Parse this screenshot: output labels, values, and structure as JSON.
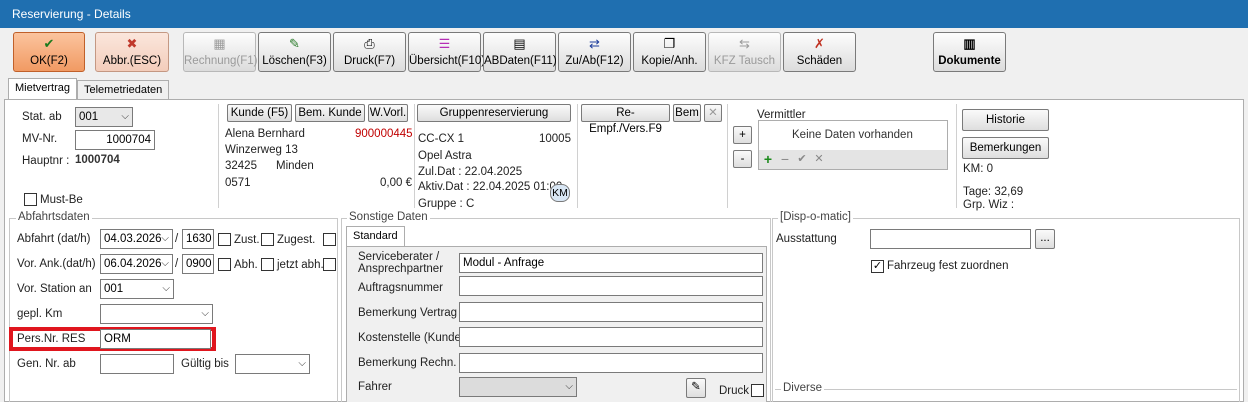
{
  "window": {
    "title": "Reservierung - Details"
  },
  "toolbar": {
    "ok": "OK(F2)",
    "abbr": "Abbr.(ESC)",
    "rechnung": "Rechnung(F1)",
    "loeschen": "Löschen(F3)",
    "druck": "Druck(F7)",
    "uebersicht": "Übersicht(F10)",
    "abdaten": "ABDaten(F11)",
    "zuab": "Zu/Ab(F12)",
    "kopie": "Kopie/Anh.",
    "kfz": "KFZ Tausch",
    "schaeden": "Schäden",
    "dokumente": "Dokumente"
  },
  "tabs": {
    "mietvertrag": "Mietvertrag",
    "telemetrie": "Telemetriedaten"
  },
  "header": {
    "stat_label": "Stat. ab",
    "stat_value": "001",
    "mv_label": "MV-Nr.",
    "mv_value": "1000704",
    "haupt_label": "Hauptnr :",
    "haupt_value": "1000704",
    "mustbe": "Must-Be"
  },
  "kunde": {
    "btn_kunde": "Kunde (F5)",
    "btn_bem": "Bem. Kunde",
    "btn_wvorl": "W.Vorl.",
    "name": "Alena Bernhard",
    "nr": "900000445",
    "street": "Winzerweg 13",
    "zip": "32425",
    "city": "Minden",
    "code": "0571",
    "amount": "0,00 €"
  },
  "fahrzeug": {
    "btn_gruppe": "Gruppenreservierung",
    "kennz": "CC-CX 1",
    "nr": "10005",
    "model": "Opel Astra",
    "zul": "Zul.Dat :  22.04.2025",
    "aktiv": "Aktiv.Dat : 22.04.2025 01:00",
    "gruppe": "Gruppe :   C",
    "km_btn": "KM"
  },
  "empf": {
    "btn_re": "Re-Empf./Vers.F9",
    "btn_bem": "Bem",
    "btn_x": "✕"
  },
  "vermittler": {
    "label": "Vermittler",
    "empty": "Keine Daten vorhanden",
    "plus": "+",
    "minus": "-"
  },
  "right": {
    "historie": "Historie",
    "bemerkungen": "Bemerkungen",
    "km": "KM: 0",
    "tage": "Tage: 32,69",
    "grp": "Grp. Wiz :"
  },
  "abfahrt": {
    "title": "Abfahrtsdaten",
    "abfahrt_label": "Abfahrt (dat/h)",
    "abfahrt_date": "04.03.2026",
    "abfahrt_time": "1630",
    "zust": "Zust.",
    "zugest": "Zugest.",
    "ank_label": "Vor. Ank.(dat/h)",
    "ank_date": "06.04.2026",
    "ank_time": "0900",
    "abh": "Abh.",
    "jetzt": "jetzt abh.",
    "station_label": "Vor. Station an",
    "station_value": "001",
    "km_label": "gepl. Km",
    "pers_label": "Pers.Nr. RES",
    "pers_value": "ORM",
    "gen_label": "Gen. Nr. ab",
    "gueltig_label": "Gültig bis",
    "sep": "/"
  },
  "sonstige": {
    "title": "Sonstige Daten",
    "tab": "Standard",
    "service_label": "Serviceberater / Ansprechpartner",
    "service_value": "Modul - Anfrage",
    "auftrag": "Auftragsnummer",
    "bem_vertrag": "Bemerkung Vertrag",
    "kosten": "Kostenstelle (Kunde)",
    "bem_rechn": "Bemerkung Rechn.",
    "fahrer": "Fahrer",
    "druck": "Druck"
  },
  "dispo": {
    "title": "[Disp-o-matic]",
    "ausstattung": "Ausstattung",
    "dots": "...",
    "fest": "Fahrzeug fest zuordnen",
    "diverse": "Diverse"
  },
  "colors": {
    "highlight": "#e0161e",
    "accent": "#1f6fb0",
    "nr_red": "#c00000"
  }
}
